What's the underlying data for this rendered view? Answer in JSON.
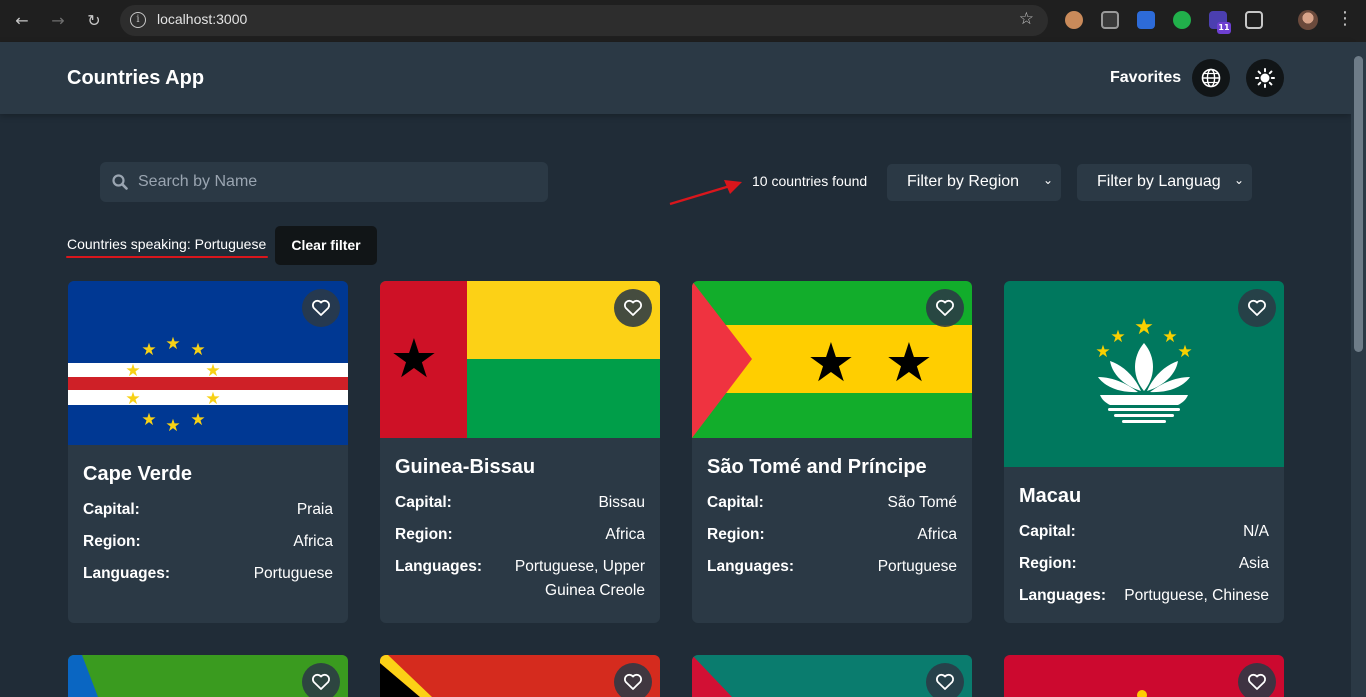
{
  "browser": {
    "url": "localhost:3000",
    "extension_badge": "11"
  },
  "header": {
    "title": "Countries App",
    "favorites_label": "Favorites"
  },
  "controls": {
    "search_placeholder": "Search by Name",
    "count_text": "10 countries found",
    "region_select": "Filter by Region",
    "language_select": "Filter by Languag",
    "active_filter_text": "Countries speaking: Portuguese",
    "clear_filter_label": "Clear filter"
  },
  "labels": {
    "capital": "Capital:",
    "region": "Region:",
    "languages": "Languages:"
  },
  "countries": [
    {
      "name": "Cape Verde",
      "capital": "Praia",
      "region": "Africa",
      "languages": "Portuguese",
      "flag": "cape-verde"
    },
    {
      "name": "Guinea-Bissau",
      "capital": "Bissau",
      "region": "Africa",
      "languages": "Portuguese, Upper Guinea Creole",
      "flag": "guinea-bissau"
    },
    {
      "name": "São Tomé and Príncipe",
      "capital": "São Tomé",
      "region": "Africa",
      "languages": "Portuguese",
      "flag": "sao-tome-and-principe"
    },
    {
      "name": "Macau",
      "capital": "N/A",
      "region": "Asia",
      "languages": "Portuguese, Chinese",
      "flag": "macau"
    }
  ],
  "colors": {
    "background": "#202c37",
    "element": "#2b3945",
    "accent_red": "#d9161c"
  }
}
